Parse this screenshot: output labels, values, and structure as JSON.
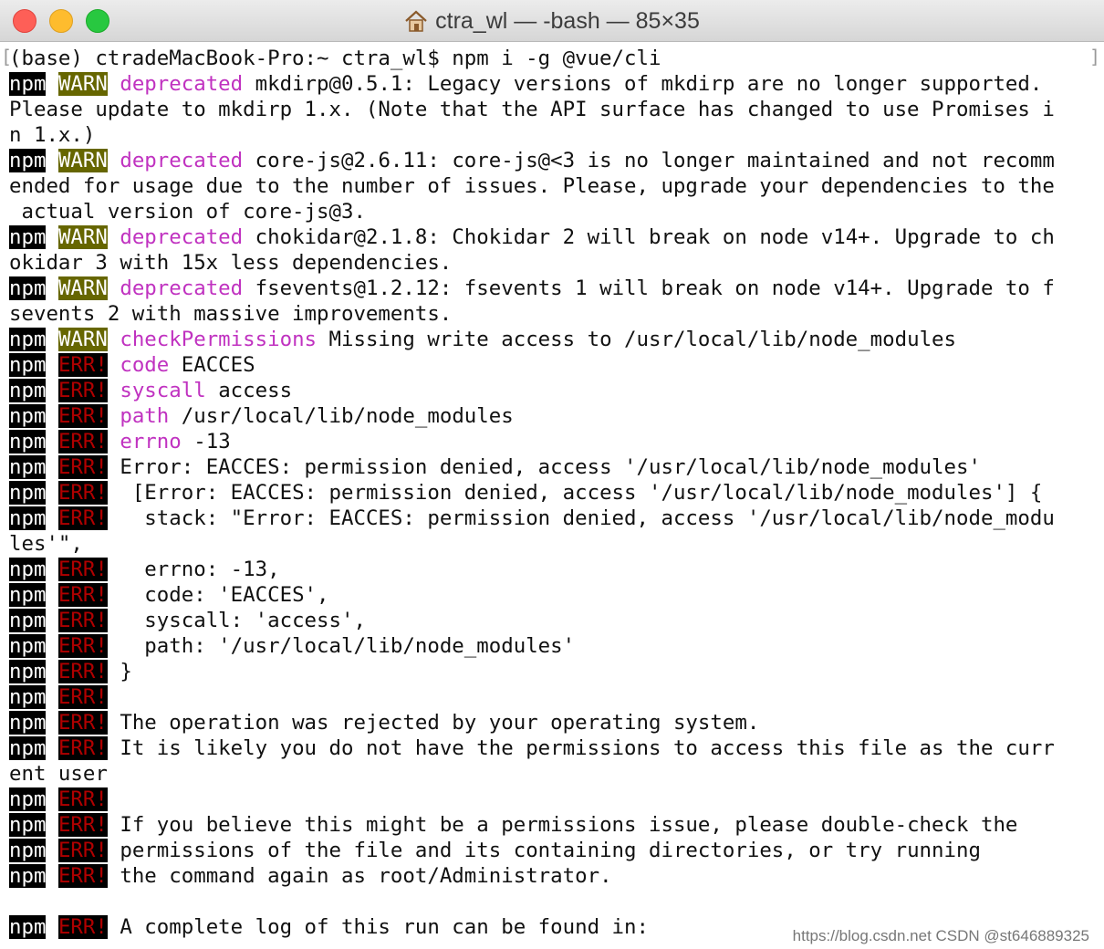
{
  "window": {
    "title": "ctra_wl — -bash — 85×35"
  },
  "terminal": {
    "lines": [
      [
        {
          "t": "(base) ctradeMacBook-Pro:~ ctra_wl$ npm i -g @vue/cli"
        }
      ],
      [
        {
          "t": "npm",
          "c": "npm"
        },
        {
          "t": " "
        },
        {
          "t": "WARN",
          "c": "warn"
        },
        {
          "t": " "
        },
        {
          "t": "deprecated",
          "c": "mag"
        },
        {
          "t": " mkdirp@0.5.1: Legacy versions of mkdirp are no longer supported."
        }
      ],
      [
        {
          "t": "Please update to mkdirp 1.x. (Note that the API surface has changed to use Promises i"
        }
      ],
      [
        {
          "t": "n 1.x.)"
        }
      ],
      [
        {
          "t": "npm",
          "c": "npm"
        },
        {
          "t": " "
        },
        {
          "t": "WARN",
          "c": "warn"
        },
        {
          "t": " "
        },
        {
          "t": "deprecated",
          "c": "mag"
        },
        {
          "t": " core-js@2.6.11: core-js@<3 is no longer maintained and not recomm"
        }
      ],
      [
        {
          "t": "ended for usage due to the number of issues. Please, upgrade your dependencies to the"
        }
      ],
      [
        {
          "t": " actual version of core-js@3."
        }
      ],
      [
        {
          "t": "npm",
          "c": "npm"
        },
        {
          "t": " "
        },
        {
          "t": "WARN",
          "c": "warn"
        },
        {
          "t": " "
        },
        {
          "t": "deprecated",
          "c": "mag"
        },
        {
          "t": " chokidar@2.1.8: Chokidar 2 will break on node v14+. Upgrade to ch"
        }
      ],
      [
        {
          "t": "okidar 3 with 15x less dependencies."
        }
      ],
      [
        {
          "t": "npm",
          "c": "npm"
        },
        {
          "t": " "
        },
        {
          "t": "WARN",
          "c": "warn"
        },
        {
          "t": " "
        },
        {
          "t": "deprecated",
          "c": "mag"
        },
        {
          "t": " fsevents@1.2.12: fsevents 1 will break on node v14+. Upgrade to f"
        }
      ],
      [
        {
          "t": "sevents 2 with massive improvements."
        }
      ],
      [
        {
          "t": "npm",
          "c": "npm"
        },
        {
          "t": " "
        },
        {
          "t": "WARN",
          "c": "warn"
        },
        {
          "t": " "
        },
        {
          "t": "checkPermissions",
          "c": "mag"
        },
        {
          "t": " Missing write access to /usr/local/lib/node_modules"
        }
      ],
      [
        {
          "t": "npm",
          "c": "npm"
        },
        {
          "t": " "
        },
        {
          "t": "ERR!",
          "c": "err"
        },
        {
          "t": " "
        },
        {
          "t": "code",
          "c": "mag"
        },
        {
          "t": " EACCES"
        }
      ],
      [
        {
          "t": "npm",
          "c": "npm"
        },
        {
          "t": " "
        },
        {
          "t": "ERR!",
          "c": "err"
        },
        {
          "t": " "
        },
        {
          "t": "syscall",
          "c": "mag"
        },
        {
          "t": " access"
        }
      ],
      [
        {
          "t": "npm",
          "c": "npm"
        },
        {
          "t": " "
        },
        {
          "t": "ERR!",
          "c": "err"
        },
        {
          "t": " "
        },
        {
          "t": "path",
          "c": "mag"
        },
        {
          "t": " /usr/local/lib/node_modules"
        }
      ],
      [
        {
          "t": "npm",
          "c": "npm"
        },
        {
          "t": " "
        },
        {
          "t": "ERR!",
          "c": "err"
        },
        {
          "t": " "
        },
        {
          "t": "errno",
          "c": "mag"
        },
        {
          "t": " -13"
        }
      ],
      [
        {
          "t": "npm",
          "c": "npm"
        },
        {
          "t": " "
        },
        {
          "t": "ERR!",
          "c": "err"
        },
        {
          "t": " Error: EACCES: permission denied, access '/usr/local/lib/node_modules'"
        }
      ],
      [
        {
          "t": "npm",
          "c": "npm"
        },
        {
          "t": " "
        },
        {
          "t": "ERR!",
          "c": "err"
        },
        {
          "t": "  [Error: EACCES: permission denied, access '/usr/local/lib/node_modules'] {"
        }
      ],
      [
        {
          "t": "npm",
          "c": "npm"
        },
        {
          "t": " "
        },
        {
          "t": "ERR!",
          "c": "err"
        },
        {
          "t": "   stack: \"Error: EACCES: permission denied, access '/usr/local/lib/node_modu"
        }
      ],
      [
        {
          "t": "les'\","
        }
      ],
      [
        {
          "t": "npm",
          "c": "npm"
        },
        {
          "t": " "
        },
        {
          "t": "ERR!",
          "c": "err"
        },
        {
          "t": "   errno: -13,"
        }
      ],
      [
        {
          "t": "npm",
          "c": "npm"
        },
        {
          "t": " "
        },
        {
          "t": "ERR!",
          "c": "err"
        },
        {
          "t": "   code: 'EACCES',"
        }
      ],
      [
        {
          "t": "npm",
          "c": "npm"
        },
        {
          "t": " "
        },
        {
          "t": "ERR!",
          "c": "err"
        },
        {
          "t": "   syscall: 'access',"
        }
      ],
      [
        {
          "t": "npm",
          "c": "npm"
        },
        {
          "t": " "
        },
        {
          "t": "ERR!",
          "c": "err"
        },
        {
          "t": "   path: '/usr/local/lib/node_modules'"
        }
      ],
      [
        {
          "t": "npm",
          "c": "npm"
        },
        {
          "t": " "
        },
        {
          "t": "ERR!",
          "c": "err"
        },
        {
          "t": " }"
        }
      ],
      [
        {
          "t": "npm",
          "c": "npm"
        },
        {
          "t": " "
        },
        {
          "t": "ERR!",
          "c": "err"
        }
      ],
      [
        {
          "t": "npm",
          "c": "npm"
        },
        {
          "t": " "
        },
        {
          "t": "ERR!",
          "c": "err"
        },
        {
          "t": " The operation was rejected by your operating system."
        }
      ],
      [
        {
          "t": "npm",
          "c": "npm"
        },
        {
          "t": " "
        },
        {
          "t": "ERR!",
          "c": "err"
        },
        {
          "t": " It is likely you do not have the permissions to access this file as the curr"
        }
      ],
      [
        {
          "t": "ent user"
        }
      ],
      [
        {
          "t": "npm",
          "c": "npm"
        },
        {
          "t": " "
        },
        {
          "t": "ERR!",
          "c": "err"
        }
      ],
      [
        {
          "t": "npm",
          "c": "npm"
        },
        {
          "t": " "
        },
        {
          "t": "ERR!",
          "c": "err"
        },
        {
          "t": " If you believe this might be a permissions issue, please double-check the"
        }
      ],
      [
        {
          "t": "npm",
          "c": "npm"
        },
        {
          "t": " "
        },
        {
          "t": "ERR!",
          "c": "err"
        },
        {
          "t": " permissions of the file and its containing directories, or try running"
        }
      ],
      [
        {
          "t": "npm",
          "c": "npm"
        },
        {
          "t": " "
        },
        {
          "t": "ERR!",
          "c": "err"
        },
        {
          "t": " the command again as root/Administrator."
        }
      ],
      [
        {
          "t": ""
        }
      ],
      [
        {
          "t": "npm",
          "c": "npm"
        },
        {
          "t": " "
        },
        {
          "t": "ERR!",
          "c": "err"
        },
        {
          "t": " A complete log of this run can be found in:"
        }
      ]
    ]
  },
  "watermark": "https://blog.csdn.net CSDN @st646889325",
  "colors": {
    "magenta": "#c032c0",
    "warn_bg": "#666600",
    "err_fg": "#b00000"
  },
  "icons": {
    "title": "home-icon"
  }
}
